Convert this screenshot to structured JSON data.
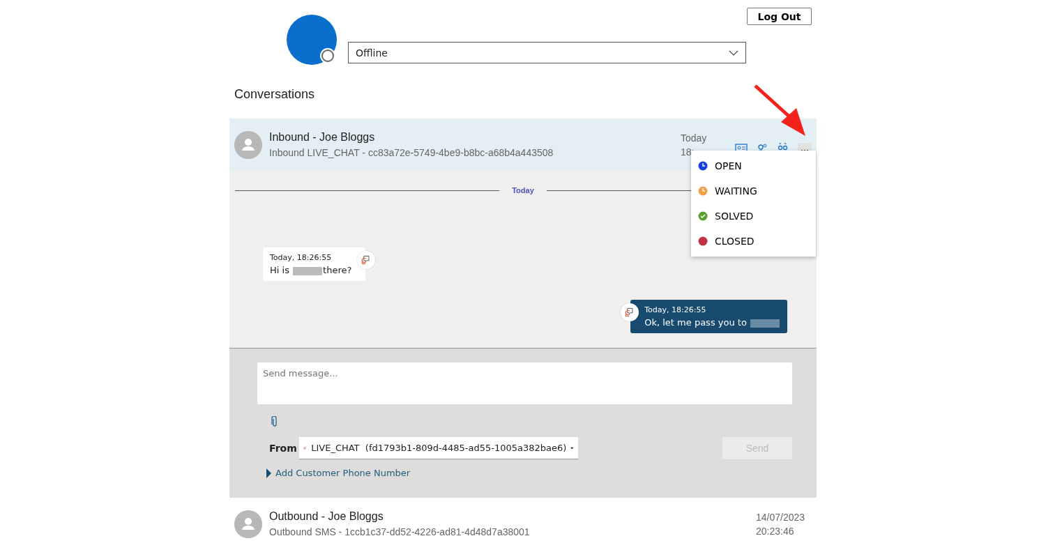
{
  "header": {
    "logout": "Log Out",
    "presence": {
      "value": "Offline"
    }
  },
  "section_title": "Conversations",
  "conversations": [
    {
      "title": "Inbound - Joe Bloggs",
      "subtitle": "Inbound LIVE_CHAT - cc83a72e-5749-4be9-b8bc-a68b4a443508",
      "date": "Today",
      "time": "18:",
      "expanded": true,
      "day_divider": "Today",
      "messages": [
        {
          "kind": "incoming",
          "timestamp": "Today, 18:26:55",
          "text_before": "Hi is",
          "text_after": "there?"
        },
        {
          "kind": "outgoing",
          "timestamp": "Today, 18:26:55",
          "text_before": "Ok, let me pass you to"
        }
      ],
      "composer": {
        "placeholder": "Send message...",
        "from_label": "From",
        "from_value": "LIVE_CHAT  (fd1793b1-809d-4485-ad55-1005a382bae6)",
        "send": "Send",
        "send_disabled": true,
        "add_phone": "Add Customer Phone Number"
      },
      "status_menu": [
        {
          "label": "OPEN",
          "kind": "clock",
          "color": "#1a3fe0"
        },
        {
          "label": "WAITING",
          "kind": "clock",
          "color": "#f4a04a"
        },
        {
          "label": "SOLVED",
          "kind": "check",
          "color": "#5aa02c"
        },
        {
          "label": "CLOSED",
          "kind": "dot",
          "color": "#c4314b"
        }
      ]
    },
    {
      "title": "Outbound - Joe Bloggs",
      "subtitle": "Outbound SMS - 1ccb1c37-dd52-4226-ad81-4d48d7a38001",
      "date": "14/07/2023",
      "time": "20:23:46",
      "expanded": false
    }
  ]
}
